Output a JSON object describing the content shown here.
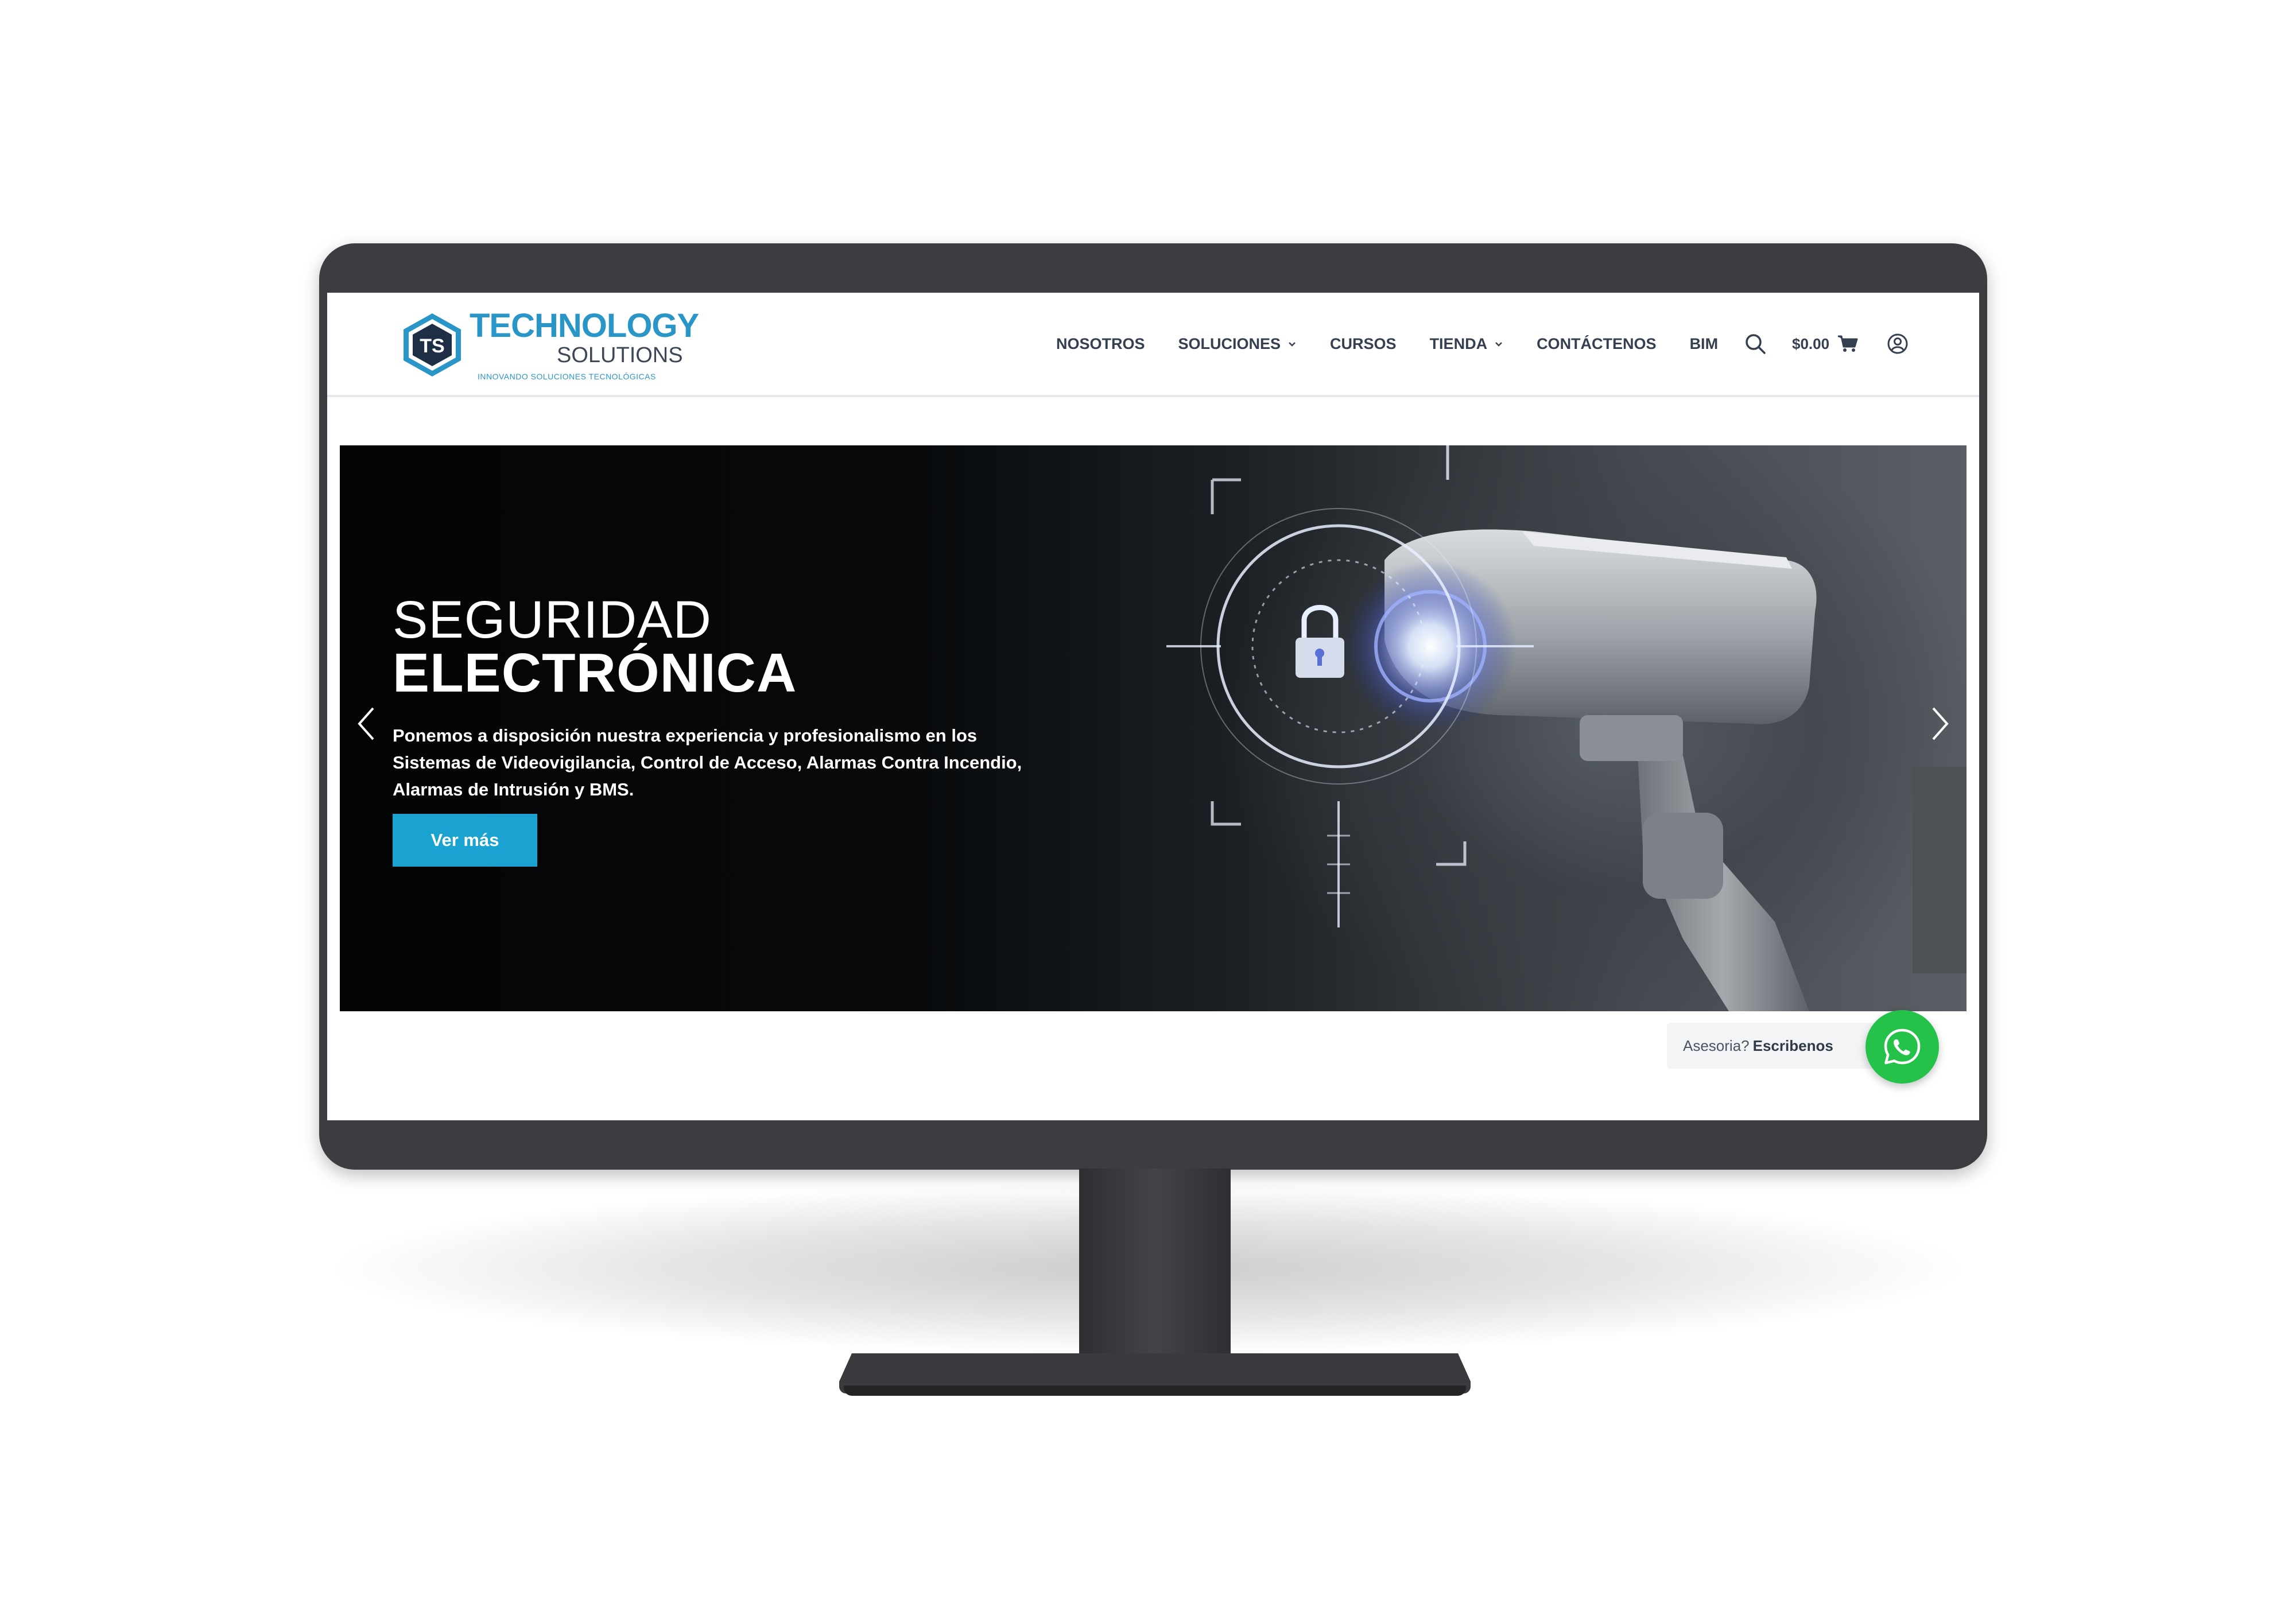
{
  "brand": {
    "name": "TECHNOLOGY",
    "subname": "SOLUTIONS",
    "tagline": "INNOVANDO SOLUCIONES TECNOLÓGICAS",
    "accent": "#2a96c8"
  },
  "nav": {
    "items": [
      {
        "label": "NOSOTROS",
        "has_dropdown": false
      },
      {
        "label": "SOLUCIONES",
        "has_dropdown": true
      },
      {
        "label": "CURSOS",
        "has_dropdown": false
      },
      {
        "label": "TIENDA",
        "has_dropdown": true
      },
      {
        "label": "CONTÁCTENOS",
        "has_dropdown": false
      },
      {
        "label": "BIM",
        "has_dropdown": false
      }
    ],
    "cart_total": "$0.00",
    "icons": [
      "search-icon",
      "cart-icon",
      "account-icon"
    ]
  },
  "hero": {
    "title_line1": "SEGURIDAD",
    "title_line2": "ELECTRÓNICA",
    "description": "Ponemos a disposición nuestra experiencia y profesionalismo en los Sistemas de Videovigilancia, Control de Acceso, Alarmas Contra Incendio, Alarmas de Intrusión y BMS.",
    "button_label": "Ver más",
    "button_color": "#1aa3d0"
  },
  "whatsapp": {
    "label_prefix": "Asesoria?",
    "label_action": "Escribenos",
    "color": "#25c24a"
  }
}
